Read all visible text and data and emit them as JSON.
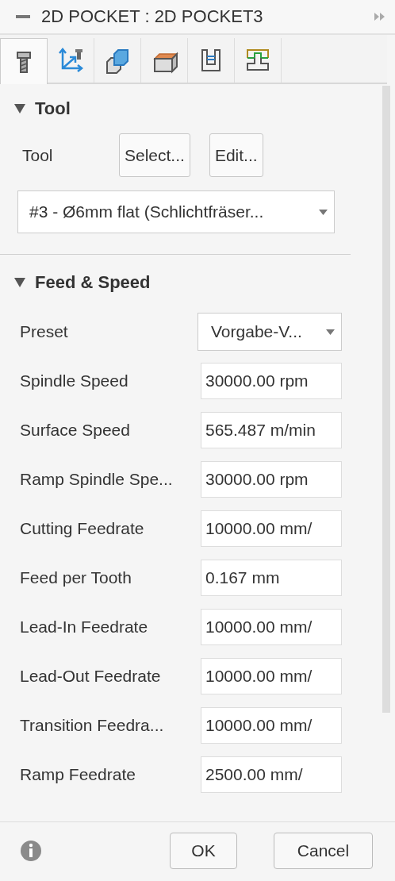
{
  "window": {
    "title": "2D POCKET : 2D POCKET3"
  },
  "tabs": [
    {
      "selected": true
    },
    {
      "selected": false
    },
    {
      "selected": false
    },
    {
      "selected": false
    },
    {
      "selected": false
    },
    {
      "selected": false
    }
  ],
  "tool_section": {
    "title": "Tool",
    "expanded": true,
    "label": "Tool",
    "buttons": [
      "Select...",
      "Edit..."
    ],
    "tool_dropdown": "#3 - Ø6mm flat (Schlichtfräser..."
  },
  "feed_section": {
    "title": "Feed & Speed",
    "expanded": true,
    "rows": [
      {
        "label": "Preset",
        "kind": "dropdown",
        "value": "Vorgabe-V..."
      },
      {
        "label": "Spindle Speed",
        "kind": "field",
        "value": "30000.00 rpm"
      },
      {
        "label": "Surface Speed",
        "kind": "field",
        "value": "565.487 m/min"
      },
      {
        "label": "Ramp Spindle Spe...",
        "kind": "field",
        "value": "30000.00 rpm"
      },
      {
        "label": "Cutting Feedrate",
        "kind": "field",
        "value": "10000.00 mm/"
      },
      {
        "label": "Feed per Tooth",
        "kind": "field",
        "value": "0.167 mm"
      },
      {
        "label": "Lead-In Feedrate",
        "kind": "field",
        "value": "10000.00 mm/"
      },
      {
        "label": "Lead-Out Feedrate",
        "kind": "field",
        "value": "10000.00 mm/"
      },
      {
        "label": "Transition Feedra...",
        "kind": "field",
        "value": "10000.00 mm/"
      },
      {
        "label": "Ramp Feedrate",
        "kind": "field",
        "value": "2500.00 mm/"
      }
    ]
  },
  "footer": {
    "buttons": [
      "OK",
      "Cancel"
    ]
  }
}
